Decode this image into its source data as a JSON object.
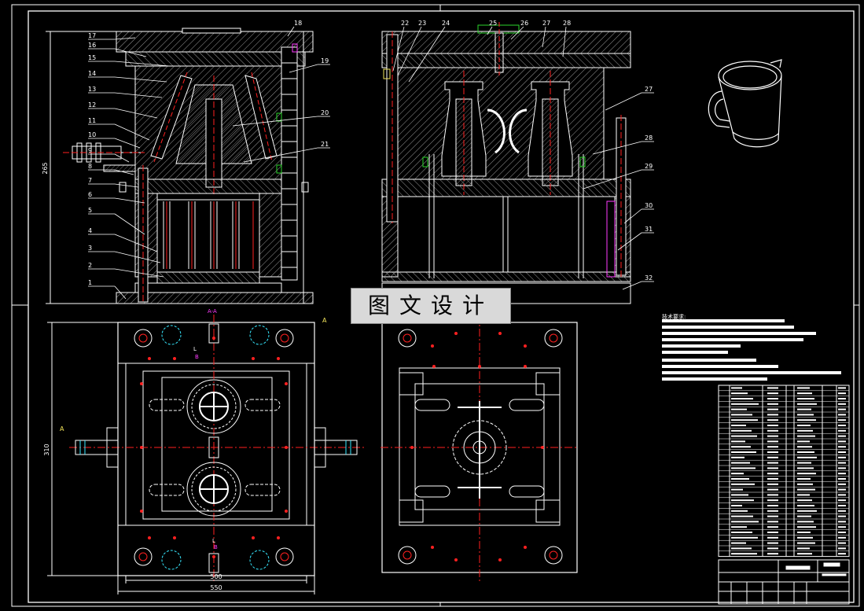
{
  "sheet": {
    "background": "#000000",
    "line_color": "#ffffff",
    "hatch_color": "#cfcfcf",
    "center_color": "#ff2020",
    "green": "#2bd62b",
    "magenta": "#ff3bff",
    "yellow": "#f1e35a",
    "cyan": "#36e8ff"
  },
  "watermark": "图文设计",
  "notes_title": "技术要求:",
  "left_callouts": [
    "17",
    "16",
    "15",
    "14",
    "13",
    "12",
    "11",
    "10",
    "9",
    "8",
    "7",
    "6",
    "5",
    "4",
    "3",
    "2",
    "1"
  ],
  "top_callouts_left": [
    "18"
  ],
  "right_callouts_left": [
    "19",
    "20",
    "21"
  ],
  "top_callouts_right": [
    "22",
    "23",
    "24",
    "25",
    "26",
    "27",
    "28"
  ],
  "right_callouts_right": [
    "27",
    "28",
    "29",
    "30",
    "31",
    "32"
  ],
  "dims": {
    "height_left": "265",
    "plan_height": "310",
    "plan_width_inner": "500",
    "plan_width_outer": "550"
  },
  "section_marks": {
    "aa": "A-A",
    "a": "A",
    "b": "B",
    "l": "L"
  }
}
